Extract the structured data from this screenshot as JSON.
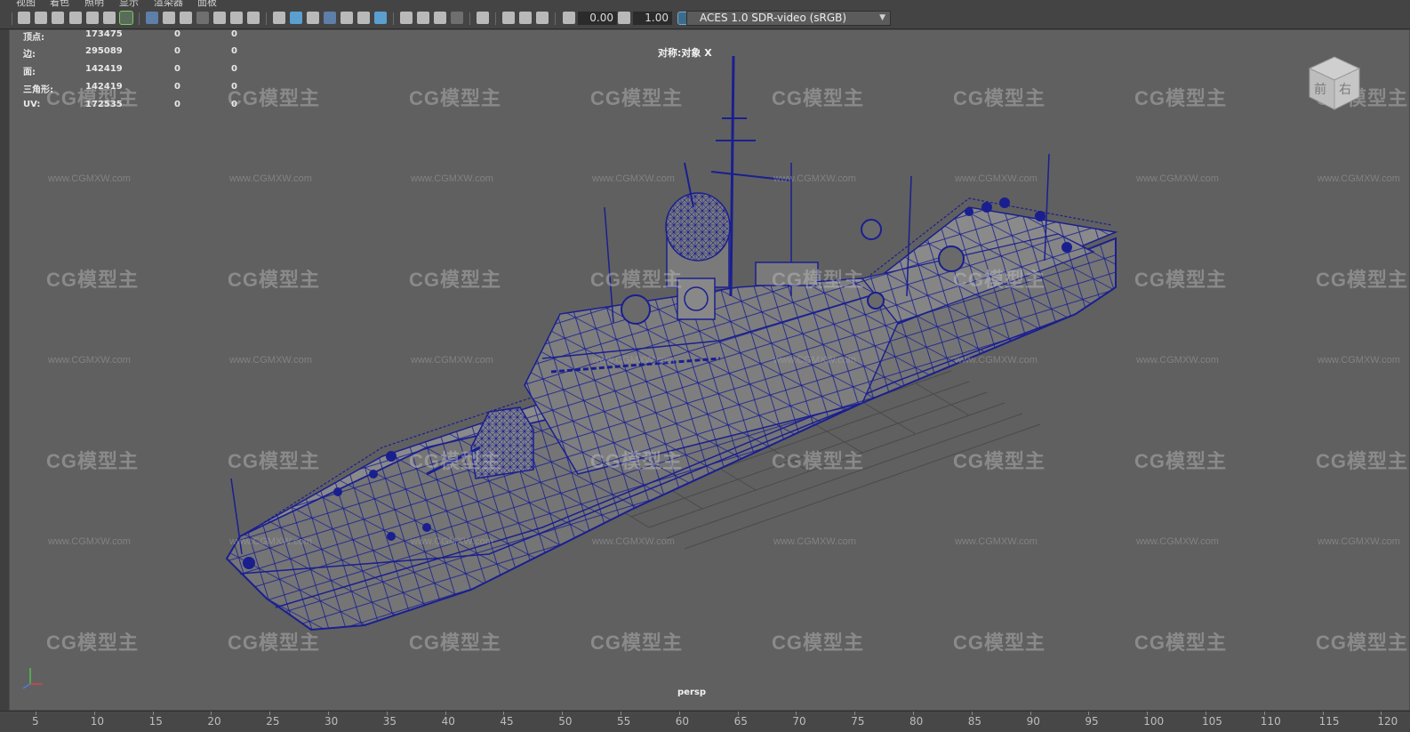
{
  "menu": [
    "视图",
    "着色",
    "照明",
    "显示",
    "渲染器",
    "面板"
  ],
  "toolbar": {
    "exposure_value": "0.00",
    "gamma_value": "1.00",
    "colorspace": "ACES 1.0 SDR-video (sRGB)"
  },
  "hud": {
    "rows": [
      {
        "label": "顶点:",
        "value": "173475",
        "c2": "0",
        "c3": "0"
      },
      {
        "label": "边:",
        "value": "295089",
        "c2": "0",
        "c3": "0"
      },
      {
        "label": "面:",
        "value": "142419",
        "c2": "0",
        "c3": "0"
      },
      {
        "label": "三角形:",
        "value": "142419",
        "c2": "0",
        "c3": "0"
      },
      {
        "label": "UV:",
        "value": "172535",
        "c2": "0",
        "c3": "0"
      }
    ]
  },
  "viewport": {
    "symmetry": "对称:对象 X",
    "camera": "persp",
    "viewcube_front": "前",
    "viewcube_right": "右"
  },
  "watermark": {
    "logo": "CG模型主",
    "url": "www.CGMXW.com"
  },
  "timeline": {
    "ticks": [
      "5",
      "10",
      "15",
      "20",
      "25",
      "30",
      "35",
      "40",
      "45",
      "50",
      "55",
      "60",
      "65",
      "70",
      "75",
      "80",
      "85",
      "90",
      "95",
      "100",
      "105",
      "110",
      "115",
      "120"
    ]
  },
  "colors": {
    "viewport_bg": "#606060",
    "wireframe": "#1a1f8f",
    "ui_bg": "#444444"
  }
}
